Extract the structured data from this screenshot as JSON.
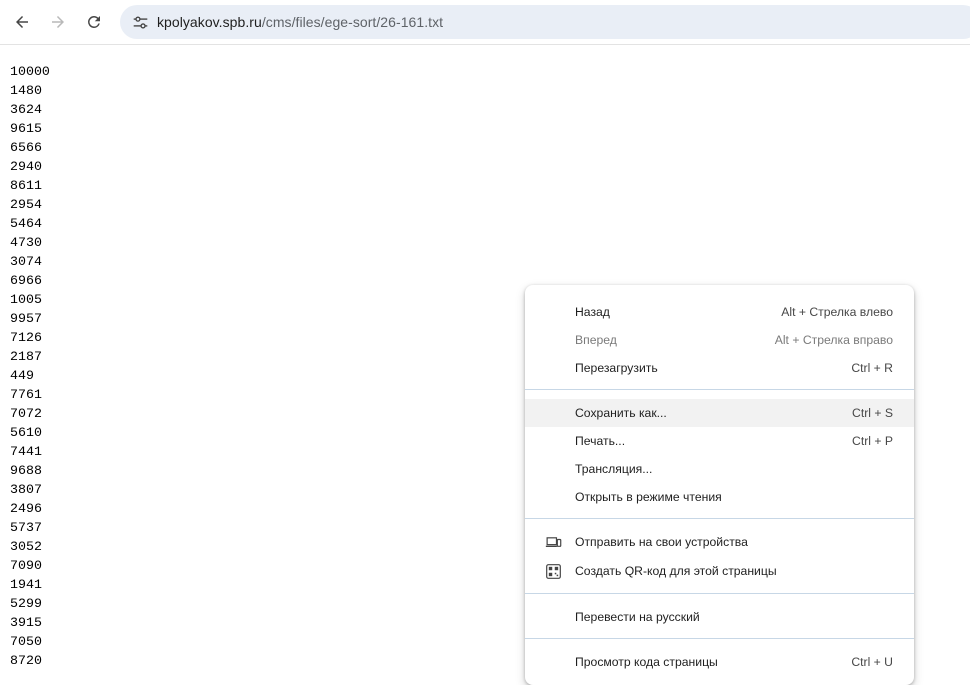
{
  "browser": {
    "url_host": "kpolyakov.spb.ru",
    "url_path": "/cms/files/ege-sort/26-161.txt"
  },
  "page": {
    "lines": [
      "10000",
      "1480",
      "3624",
      "9615",
      "6566",
      "2940",
      "8611",
      "2954",
      "5464",
      "4730",
      "3074",
      "6966",
      "1005",
      "9957",
      "7126",
      "2187",
      "449",
      "7761",
      "7072",
      "5610",
      "7441",
      "9688",
      "3807",
      "2496",
      "5737",
      "3052",
      "7090",
      "1941",
      "5299",
      "3915",
      "7050",
      "8720"
    ]
  },
  "context_menu": {
    "back": {
      "label": "Назад",
      "shortcut": "Alt + Стрелка влево"
    },
    "forward": {
      "label": "Вперед",
      "shortcut": "Alt + Стрелка вправо"
    },
    "reload": {
      "label": "Перезагрузить",
      "shortcut": "Ctrl + R"
    },
    "save_as": {
      "label": "Сохранить как...",
      "shortcut": "Ctrl + S"
    },
    "print": {
      "label": "Печать...",
      "shortcut": "Ctrl + P"
    },
    "cast": {
      "label": "Трансляция..."
    },
    "reading_mode": {
      "label": "Открыть в режиме чтения"
    },
    "send_to_devices": {
      "label": "Отправить на свои устройства",
      "icon": "devices-icon"
    },
    "create_qr": {
      "label": "Создать QR-код для этой страницы",
      "icon": "qr-code-icon"
    },
    "translate": {
      "label": "Перевести на русский"
    },
    "view_source": {
      "label": "Просмотр кода страницы",
      "shortcut": "Ctrl + U"
    }
  }
}
